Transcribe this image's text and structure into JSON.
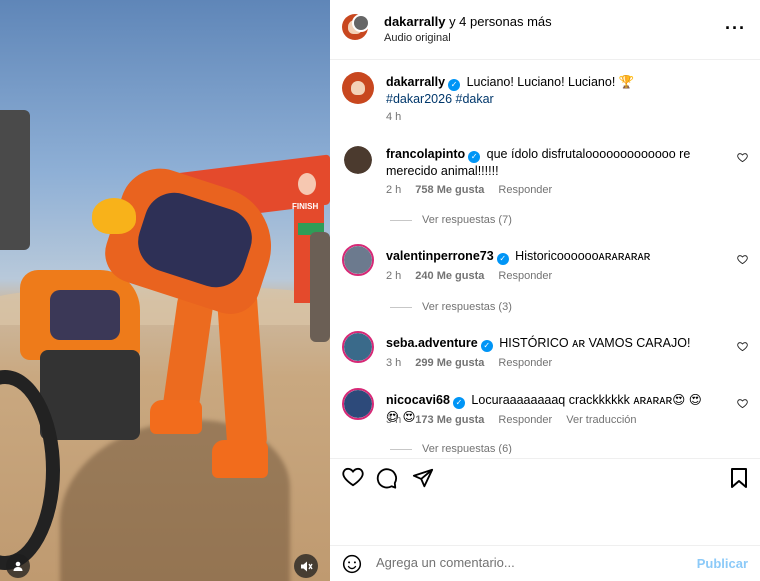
{
  "media": {
    "arch_text": "FINISH"
  },
  "header": {
    "username": "dakarrally",
    "others": "y 4 personas más",
    "audio": "Audio original"
  },
  "caption": {
    "username": "dakarrally",
    "text": "Luciano! Luciano! Luciano! 🏆",
    "hashtags": "#dakar2026 #dakar",
    "time": "4 h"
  },
  "comments": [
    {
      "username": "francolapinto",
      "text": "que ídolo disfrutalooooooooooooo re merecido animal!!!!!!",
      "time": "2 h",
      "likes": "758 Me gusta",
      "reply": "Responder",
      "replies": "Ver respuestas (7)",
      "avatar_color": "#4b3a2e"
    },
    {
      "username": "valentinperrone73",
      "text": "Historicooooooᴀʀᴀʀᴀʀᴀʀ",
      "time": "2 h",
      "likes": "240 Me gusta",
      "reply": "Responder",
      "replies": "Ver respuestas (3)",
      "avatar_color": "#6c7a8e"
    },
    {
      "username": "seba.adventure",
      "text": "HISTÓRICO ᴀʀ VAMOS CARAJO!",
      "time": "3 h",
      "likes": "299 Me gusta",
      "reply": "Responder",
      "avatar_color": "#3a6a8a"
    },
    {
      "username": "nicocavi68",
      "text": "Locuraaaaaaaaq crackkkkkk ᴀʀᴀʀᴀʀ😍 😍 😍 😍",
      "time": "3 h",
      "likes": "173 Me gusta",
      "reply": "Responder",
      "translate": "Ver traducción",
      "replies": "Ver respuestas (6)",
      "avatar_color": "#2d4a7a"
    }
  ],
  "composer": {
    "placeholder": "Agrega un comentario...",
    "publish": "Publicar"
  },
  "icons": {
    "like": "heart-icon",
    "comment": "comment-icon",
    "share": "send-icon",
    "save": "bookmark-icon",
    "emoji": "emoji-icon",
    "more": "more-icon",
    "mute": "mute-icon",
    "user_tag": "user-icon"
  }
}
